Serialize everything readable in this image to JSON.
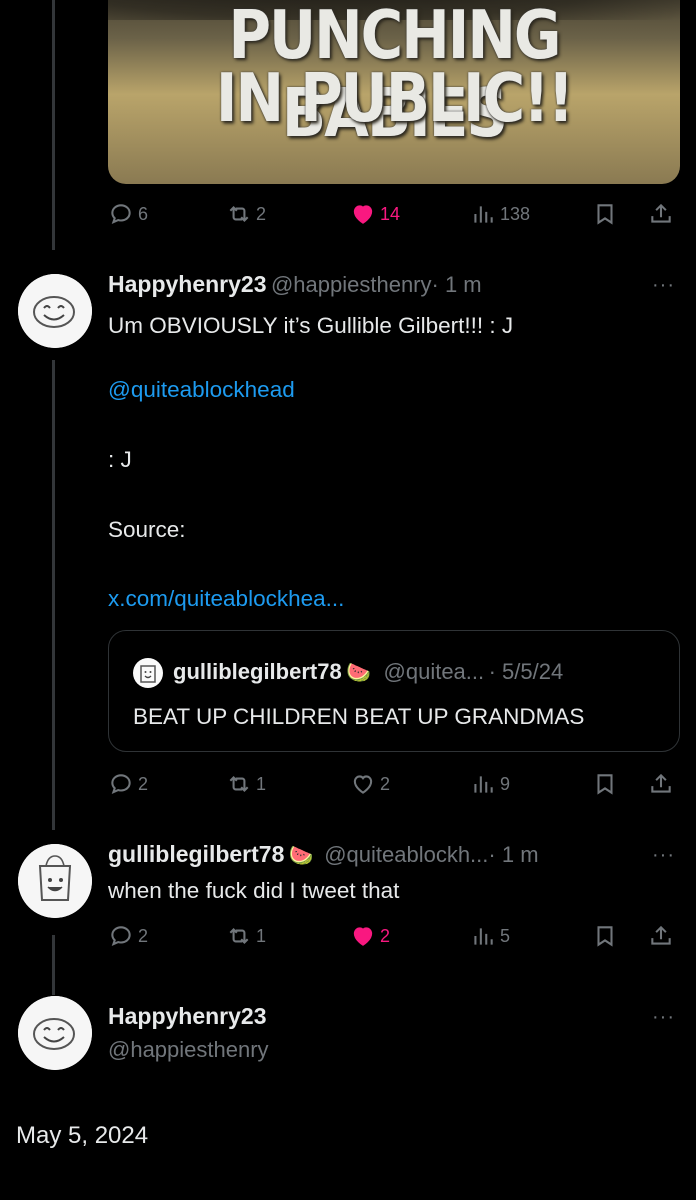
{
  "media": {
    "caption_line1": "PUNCHING BABIES",
    "caption_line2": "IN PUBLIC!!"
  },
  "top_actions": {
    "replies": "6",
    "reposts": "2",
    "likes": "14",
    "views": "138"
  },
  "reply1": {
    "name": "Happyhenry23",
    "handle": "@happiesthenry",
    "time": "· 1 m",
    "line1": "Um OBVIOUSLY it’s Gullible Gilbert!!! : J",
    "mention": "@quiteablockhead",
    "line2": ": J",
    "line3": "Source:",
    "source_link": "x.com/quiteablockhea...",
    "more": "···",
    "quote": {
      "name": "gulliblegilbert78",
      "emoji": "🍉",
      "handle": "@quitea...",
      "date": "· 5/5/24",
      "text": "BEAT UP CHILDREN BEAT UP GRANDMAS"
    },
    "actions": {
      "replies": "2",
      "reposts": "1",
      "likes": "2",
      "views": "9"
    }
  },
  "reply2": {
    "name": "gulliblegilbert78",
    "emoji": "🍉",
    "handle": "@quiteablockh...",
    "time": "· 1 m",
    "text": "when the fuck did I tweet that",
    "more": "···",
    "actions": {
      "replies": "2",
      "reposts": "1",
      "likes": "2",
      "views": "5"
    }
  },
  "main": {
    "name": "Happyhenry23",
    "handle": "@happiesthenry",
    "more": "···",
    "date": "May 5, 2024"
  },
  "colors": {
    "background": "#000000",
    "link": "#1d9bf0",
    "like": "#f91880",
    "muted": "#71767b"
  }
}
